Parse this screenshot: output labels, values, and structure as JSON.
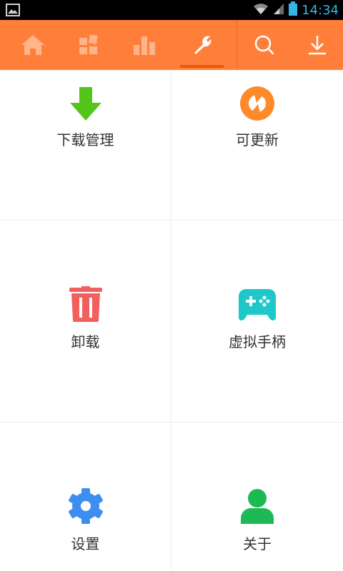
{
  "status_bar": {
    "time": "14:34"
  },
  "top_tabs": [
    {
      "name": "home",
      "icon": "home-icon"
    },
    {
      "name": "categories",
      "icon": "grid-icon"
    },
    {
      "name": "ranking",
      "icon": "bar-chart-icon"
    },
    {
      "name": "tools",
      "icon": "wrench-icon",
      "active": true
    },
    {
      "name": "search",
      "icon": "search-icon"
    },
    {
      "name": "download",
      "icon": "download-icon"
    }
  ],
  "grid_items": [
    {
      "label": "下载管理",
      "icon": "download-arrow-icon",
      "color": "#52c41a"
    },
    {
      "label": "可更新",
      "icon": "update-icon",
      "color": "#ff8a2a"
    },
    {
      "label": "卸载",
      "icon": "trash-icon",
      "color": "#f25f5c"
    },
    {
      "label": "虚拟手柄",
      "icon": "gamepad-icon",
      "color": "#1ec8c8"
    },
    {
      "label": "设置",
      "icon": "gear-icon",
      "color": "#3d8ef0"
    },
    {
      "label": "关于",
      "icon": "person-icon",
      "color": "#1db954"
    }
  ],
  "colors": {
    "topbar": "#ff7f3a",
    "tab_inactive": "#ffb48a",
    "tab_active": "#ffffff"
  }
}
